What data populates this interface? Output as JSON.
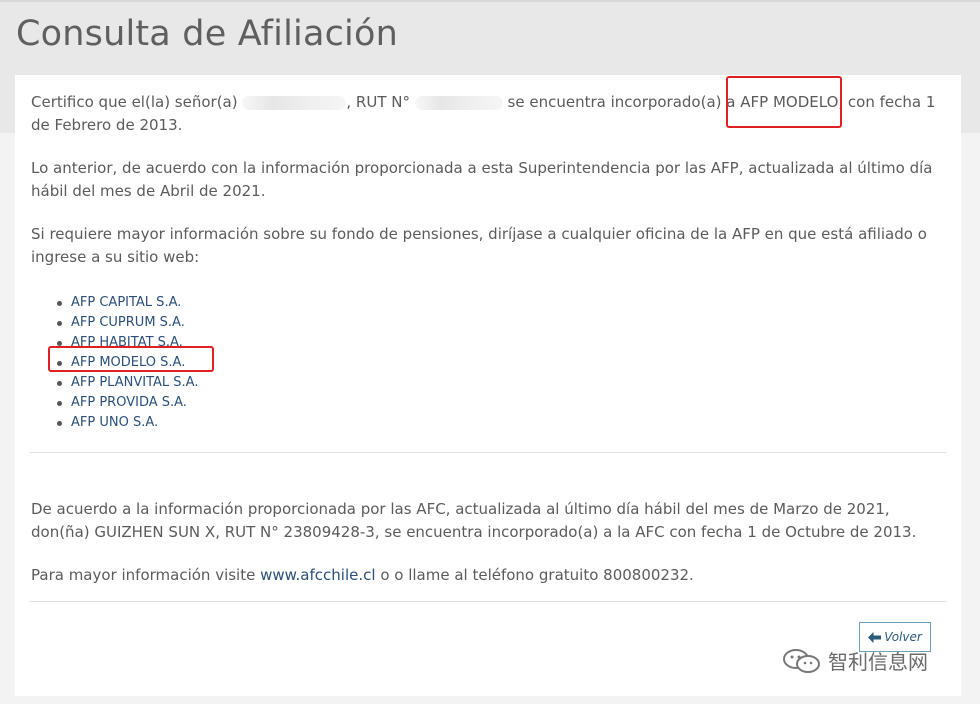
{
  "page": {
    "title": "Consulta de Afiliación"
  },
  "afp_section": {
    "p1_before_name": "Certifico que el(la) señor(a)",
    "p1_rut_label": ", RUT N°",
    "p1_mid": "se encuentra incorporado(a) a",
    "p1_afp": "AFP MODELO",
    "p1_after": ", con fecha 1 de Febrero de 2013.",
    "p2": "Lo anterior, de acuerdo con la información proporcionada a esta Superintendencia por las AFP, actualizada al último día hábil del mes de Abril de 2021.",
    "p3": "Si requiere mayor información sobre su fondo de pensiones, diríjase a cualquier oficina de la AFP en que está afiliado o ingrese a su sitio web:",
    "afp_links": [
      "AFP CAPITAL S.A.",
      "AFP CUPRUM S.A.",
      "AFP HABITAT S.A.",
      "AFP MODELO S.A.",
      "AFP PLANVITAL S.A.",
      "AFP PROVIDA S.A.",
      "AFP UNO S.A."
    ]
  },
  "afc_section": {
    "p4": "De acuerdo a la información proporcionada por las AFC, actualizada al último día hábil del mes de Marzo de 2021, don(ña) GUIZHEN SUN X, RUT N° 23809428-3, se encuentra incorporado(a) a la AFC con fecha 1 de Octubre de 2013.",
    "p5_before": "Para mayor información visite",
    "p5_link": "www.afcchile.cl",
    "p5_after": "o o llame al teléfono gratuito 800800232."
  },
  "actions": {
    "back_label": "Volver"
  },
  "watermark": {
    "text": "智利信息网"
  },
  "colors": {
    "highlight": "#e02020",
    "link": "#2a4f7a"
  }
}
